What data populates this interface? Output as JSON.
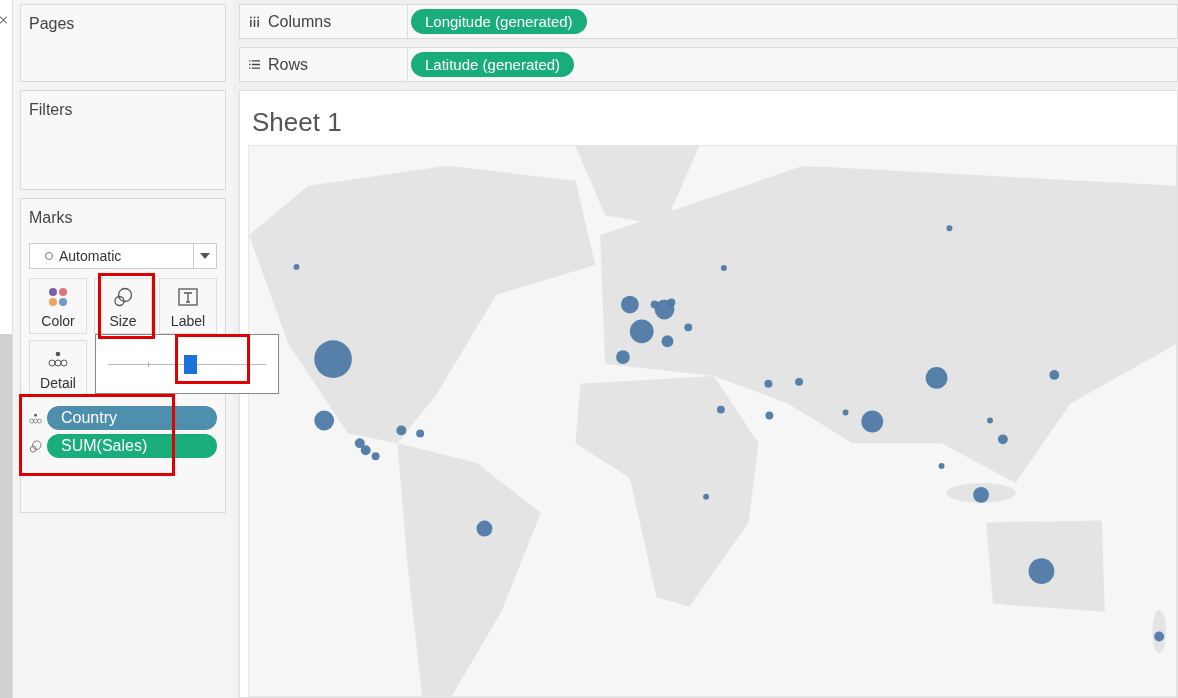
{
  "pages": {
    "title": "Pages"
  },
  "filters": {
    "title": "Filters"
  },
  "marks": {
    "title": "Marks",
    "mark_type": "Automatic",
    "cards": [
      {
        "kind": "color",
        "label": "Color"
      },
      {
        "kind": "size",
        "label": "Size"
      },
      {
        "kind": "label",
        "label": "Label"
      },
      {
        "kind": "detail",
        "label": "Detail"
      }
    ],
    "size_slider": {
      "level": 0.52
    },
    "pills": [
      {
        "kind": "detail",
        "label": "Country",
        "color": "#4e8fae"
      },
      {
        "kind": "size",
        "label": "SUM(Sales)",
        "color": "#1aad7c"
      }
    ]
  },
  "shelves": [
    {
      "kind": "columns",
      "label": "Columns",
      "pills": [
        "Longitude (generated)"
      ]
    },
    {
      "kind": "rows",
      "label": "Rows",
      "pills": [
        "Latitude (generated)"
      ]
    }
  ],
  "sheet": {
    "title": "Sheet 1"
  }
}
